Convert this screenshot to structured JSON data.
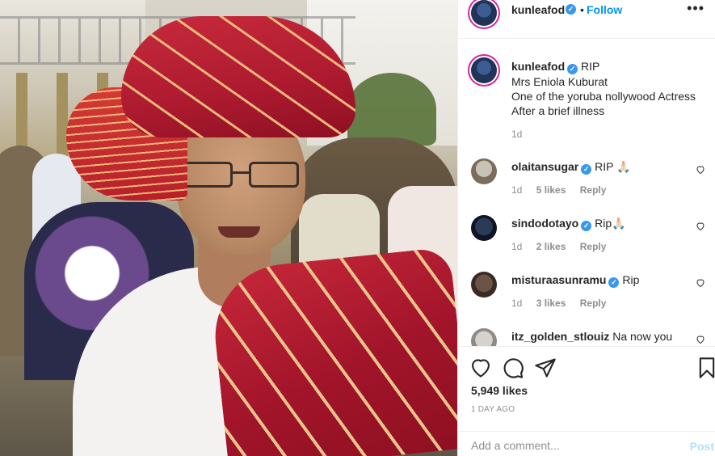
{
  "post": {
    "author": "kunleafod",
    "verified_icon": "verified-badge-icon",
    "follow_label": "Follow",
    "dot": "•",
    "more_label": "•••",
    "caption": {
      "author": "kunleafod",
      "line1": "RIP",
      "line2": "Mrs Eniola Kuburat",
      "line3": "One of the yoruba nollywood Actress",
      "line4": "After a brief illness",
      "time": "1d"
    },
    "comments": [
      {
        "author": "olaitansugar",
        "text": "RIP 🙏🏻",
        "time": "1d",
        "likes": "5 likes",
        "reply": "Reply"
      },
      {
        "author": "sindodotayo",
        "text": "Rip🙏🏻",
        "time": "1d",
        "likes": "2 likes",
        "reply": "Reply"
      },
      {
        "author": "misturaasunramu",
        "text": "Rip",
        "time": "1d",
        "likes": "3 likes",
        "reply": "Reply"
      },
      {
        "author": "itz_golden_stlouiz",
        "text": "Na now you",
        "time": "",
        "likes": "",
        "reply": ""
      }
    ],
    "likes": "5,949 likes",
    "posted": "1 DAY AGO",
    "add_comment_placeholder": "Add a comment...",
    "post_label": "Post"
  },
  "colors": {
    "link": "#0095f6",
    "verified": "#3897f0",
    "post_disabled": "#b2dffc",
    "muted": "#8e8e8e"
  }
}
